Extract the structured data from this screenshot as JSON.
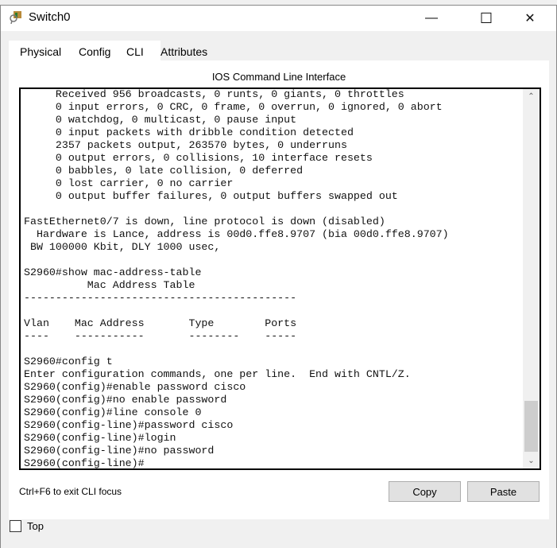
{
  "window": {
    "title": "Switch0",
    "minimize": "—",
    "maximize": "☐",
    "close": "✕"
  },
  "tabs": [
    {
      "label": "Physical"
    },
    {
      "label": "Config"
    },
    {
      "label": "CLI",
      "active": true
    },
    {
      "label": "Attributes"
    }
  ],
  "cli": {
    "heading": "IOS Command Line Interface",
    "lines": [
      "     Received 956 broadcasts, 0 runts, 0 giants, 0 throttles",
      "     0 input errors, 0 CRC, 0 frame, 0 overrun, 0 ignored, 0 abort",
      "     0 watchdog, 0 multicast, 0 pause input",
      "     0 input packets with dribble condition detected",
      "     2357 packets output, 263570 bytes, 0 underruns",
      "     0 output errors, 0 collisions, 10 interface resets",
      "     0 babbles, 0 late collision, 0 deferred",
      "     0 lost carrier, 0 no carrier",
      "     0 output buffer failures, 0 output buffers swapped out",
      "",
      "FastEthernet0/7 is down, line protocol is down (disabled)",
      "  Hardware is Lance, address is 00d0.ffe8.9707 (bia 00d0.ffe8.9707)",
      " BW 100000 Kbit, DLY 1000 usec,",
      "",
      "S2960#show mac-address-table",
      "          Mac Address Table",
      "-------------------------------------------",
      "",
      "Vlan    Mac Address       Type        Ports",
      "----    -----------       --------    -----",
      "",
      "S2960#config t",
      "Enter configuration commands, one per line.  End with CNTL/Z.",
      "S2960(config)#enable password cisco",
      "S2960(config)#no enable password",
      "S2960(config)#line console 0",
      "S2960(config-line)#password cisco",
      "S2960(config-line)#login",
      "S2960(config-line)#no password",
      "S2960(config-line)#"
    ],
    "scroll_position_percent": 95,
    "hint": "Ctrl+F6 to exit CLI focus",
    "copy_label": "Copy",
    "paste_label": "Paste"
  },
  "footer": {
    "top_label": "Top",
    "top_checked": false
  }
}
